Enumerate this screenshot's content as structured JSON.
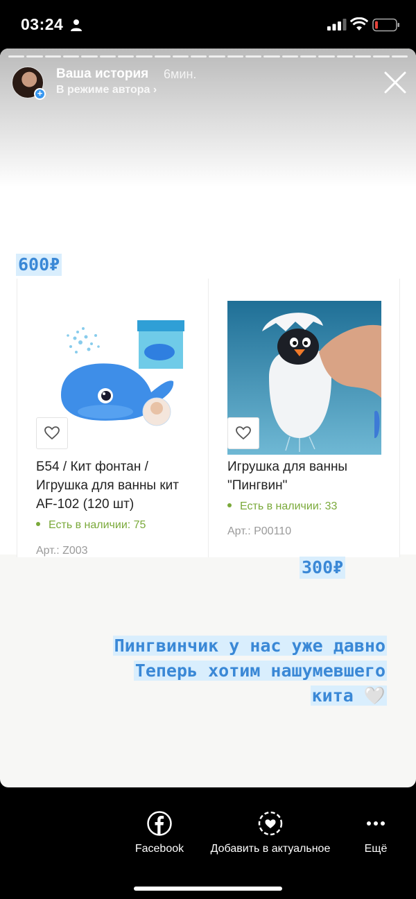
{
  "status_bar": {
    "time": "03:24",
    "icons": [
      "person-icon",
      "signal-icon",
      "wifi-icon",
      "battery-icon"
    ]
  },
  "story": {
    "title": "Ваша история",
    "time": "6мин.",
    "mode": "В режиме автора ›",
    "progress_segments": 22
  },
  "stickers": {
    "price_1": "600₽",
    "price_2": "300₽",
    "caption_lines": [
      "Пингвинчик у нас уже давно",
      "Теперь хотим нашумевшего",
      "кита 🤍"
    ]
  },
  "products": [
    {
      "name": "Б54 / Кит фонтан / Игрушка для ванны кит AF-102 (120 шт)",
      "stock": "Есть в наличии: 75",
      "sku": "Арт.: Z003"
    },
    {
      "name": "Игрушка для ванны \"Пингвин\"",
      "stock": "Есть в наличии: 33",
      "sku": "Арт.: P00110"
    }
  ],
  "actions": {
    "facebook": "Facebook",
    "highlight": "Добавить в актуальное",
    "more": "Ещё"
  },
  "colors": {
    "accent_blue": "#3a88d6",
    "sticker_bg": "#d9eefd",
    "stock_green": "#7aa93a"
  }
}
